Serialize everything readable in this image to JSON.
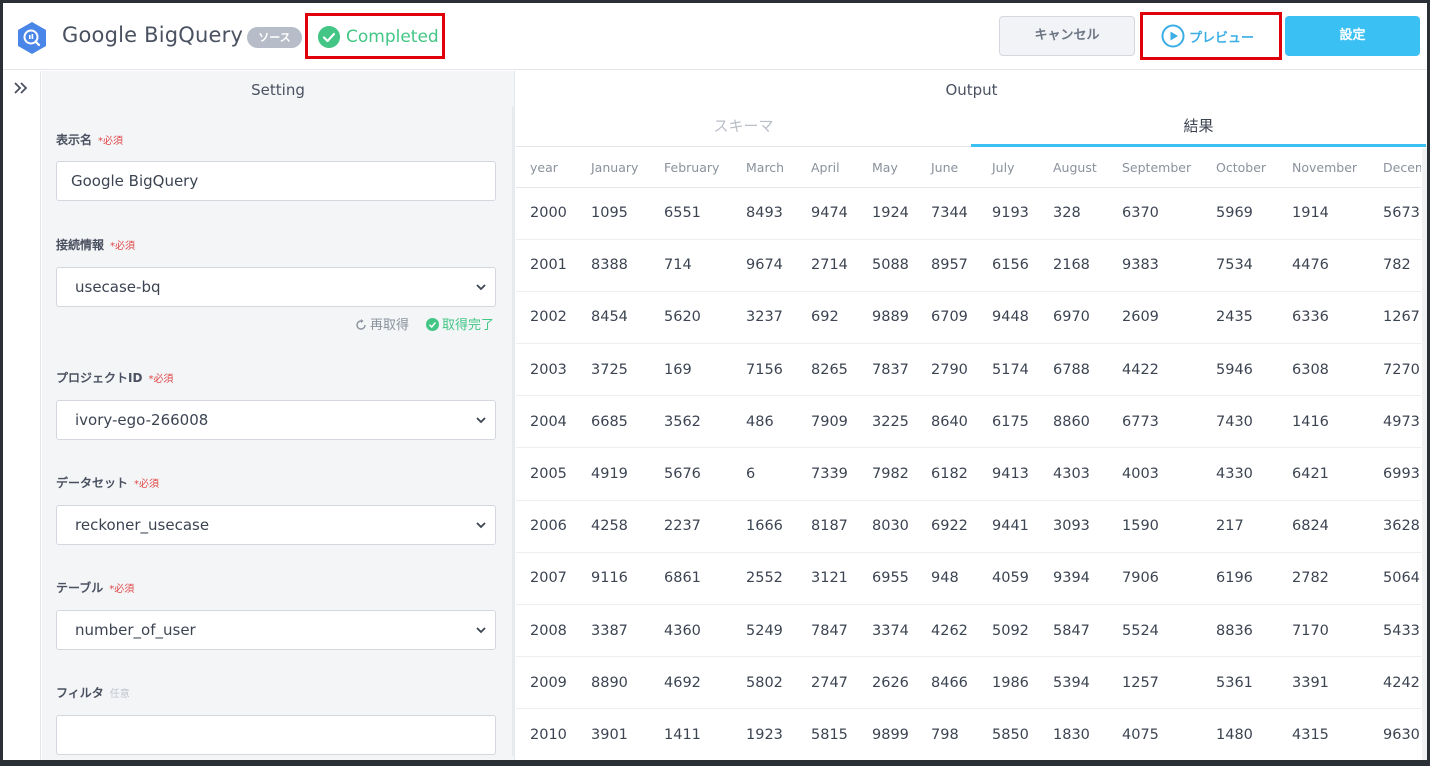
{
  "header": {
    "app_name": "Google BigQuery",
    "badge": "ソース",
    "status": "Completed",
    "cancel_label": "キャンセル",
    "preview_label": "プレビュー",
    "settings_label": "設定"
  },
  "settings": {
    "title": "Setting",
    "display_name": {
      "label": "表示名",
      "required": "*必須",
      "value": "Google BigQuery"
    },
    "connection": {
      "label": "接続情報",
      "required": "*必須",
      "value": "usecase-bq",
      "refetch": "再取得",
      "fetched": "取得完了"
    },
    "project_id": {
      "label": "プロジェクトID",
      "required": "*必須",
      "value": "ivory-ego-266008"
    },
    "dataset": {
      "label": "データセット",
      "required": "*必須",
      "value": "reckoner_usecase"
    },
    "table": {
      "label": "テーブル",
      "required": "*必須",
      "value": "number_of_user"
    },
    "filter": {
      "label": "フィルタ",
      "optional": "任意",
      "value": ""
    }
  },
  "output": {
    "title": "Output",
    "tabs": [
      "スキーマ",
      "結果"
    ],
    "active_tab": "結果",
    "columns": [
      "year",
      "January",
      "February",
      "March",
      "April",
      "May",
      "June",
      "July",
      "August",
      "September",
      "October",
      "November",
      "December"
    ],
    "rows": [
      [
        "2000",
        "1095",
        "6551",
        "8493",
        "9474",
        "1924",
        "7344",
        "9193",
        "328",
        "6370",
        "5969",
        "1914",
        "5673"
      ],
      [
        "2001",
        "8388",
        "714",
        "9674",
        "2714",
        "5088",
        "8957",
        "6156",
        "2168",
        "9383",
        "7534",
        "4476",
        "782"
      ],
      [
        "2002",
        "8454",
        "5620",
        "3237",
        "692",
        "9889",
        "6709",
        "9448",
        "6970",
        "2609",
        "2435",
        "6336",
        "1267"
      ],
      [
        "2003",
        "3725",
        "169",
        "7156",
        "8265",
        "7837",
        "2790",
        "5174",
        "6788",
        "4422",
        "5946",
        "6308",
        "7270"
      ],
      [
        "2004",
        "6685",
        "3562",
        "486",
        "7909",
        "3225",
        "8640",
        "6175",
        "8860",
        "6773",
        "7430",
        "1416",
        "4973"
      ],
      [
        "2005",
        "4919",
        "5676",
        "6",
        "7339",
        "7982",
        "6182",
        "9413",
        "4303",
        "4003",
        "4330",
        "6421",
        "6993"
      ],
      [
        "2006",
        "4258",
        "2237",
        "1666",
        "8187",
        "8030",
        "6922",
        "9441",
        "3093",
        "1590",
        "217",
        "6824",
        "3628"
      ],
      [
        "2007",
        "9116",
        "6861",
        "2552",
        "3121",
        "6955",
        "948",
        "4059",
        "9394",
        "7906",
        "6196",
        "2782",
        "5064"
      ],
      [
        "2008",
        "3387",
        "4360",
        "5249",
        "7847",
        "3374",
        "4262",
        "5092",
        "5847",
        "5524",
        "8836",
        "7170",
        "5433"
      ],
      [
        "2009",
        "8890",
        "4692",
        "5802",
        "2747",
        "2626",
        "8466",
        "1986",
        "5394",
        "1257",
        "5361",
        "3391",
        "4242"
      ],
      [
        "2010",
        "3901",
        "1411",
        "1923",
        "5815",
        "9899",
        "798",
        "5850",
        "1830",
        "4075",
        "1480",
        "4315",
        "9630"
      ]
    ]
  },
  "colors": {
    "accent": "#3bc0f3",
    "success": "#43c685",
    "highlight_box": "#e0000b",
    "required": "#e04848"
  }
}
